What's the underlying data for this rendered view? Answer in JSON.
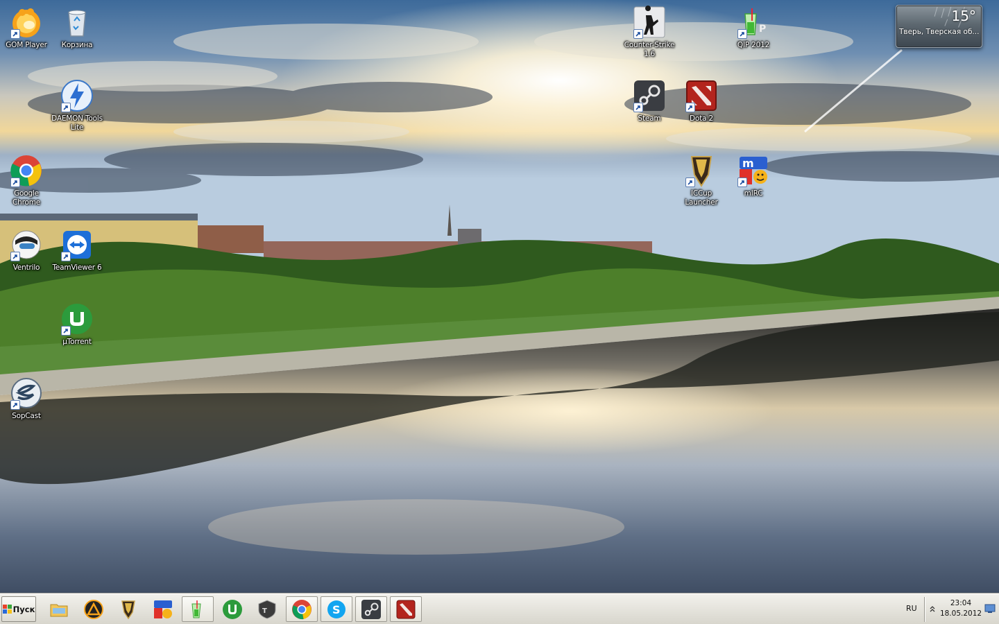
{
  "desktop": {
    "icons": [
      {
        "id": "gom-player",
        "label": "GOM Player",
        "icon": "gom-player-icon",
        "shortcut": true
      },
      {
        "id": "recycle-bin",
        "label": "Корзина",
        "icon": "recycle-bin-icon",
        "shortcut": false
      },
      {
        "id": "daemon-tools",
        "label": "DAEMON Tools Lite",
        "icon": "daemon-tools-icon",
        "shortcut": true
      },
      {
        "id": "google-chrome",
        "label": "Google Chrome",
        "icon": "chrome-icon",
        "shortcut": true
      },
      {
        "id": "ventrilo",
        "label": "Ventrilo",
        "icon": "ventrilo-icon",
        "shortcut": true
      },
      {
        "id": "teamviewer",
        "label": "TeamViewer 6",
        "icon": "teamviewer-icon",
        "shortcut": true
      },
      {
        "id": "utorrent",
        "label": "µTorrent",
        "icon": "utorrent-icon",
        "shortcut": true
      },
      {
        "id": "sopcast",
        "label": "SopCast",
        "icon": "sopcast-icon",
        "shortcut": true
      },
      {
        "id": "counter-strike",
        "label": "Counter-Strike 1.6",
        "icon": "counter-strike-icon",
        "shortcut": true
      },
      {
        "id": "qip",
        "label": "QIP 2012",
        "icon": "qip-icon",
        "shortcut": true
      },
      {
        "id": "steam",
        "label": "Steam",
        "icon": "steam-icon",
        "shortcut": true
      },
      {
        "id": "dota2",
        "label": "Dota 2",
        "icon": "dota2-icon",
        "shortcut": true
      },
      {
        "id": "iccup",
        "label": "ICCup Launcher",
        "icon": "iccup-icon",
        "shortcut": true
      },
      {
        "id": "mirc",
        "label": "mIRC",
        "icon": "mirc-icon",
        "shortcut": true
      }
    ]
  },
  "weather_gadget": {
    "temperature": "15°",
    "location": "Тверь, Тверская об..."
  },
  "taskbar": {
    "start_label": "Пуск",
    "buttons": [
      {
        "id": "explorer",
        "icon": "file-explorer-icon",
        "running": false
      },
      {
        "id": "aimp",
        "icon": "aimp-icon",
        "running": false
      },
      {
        "id": "iccup",
        "icon": "iccup-icon",
        "running": false
      },
      {
        "id": "mirc",
        "icon": "mirc-icon",
        "running": false
      },
      {
        "id": "qip",
        "icon": "qip-icon",
        "running": true
      },
      {
        "id": "utorrent",
        "icon": "utorrent-icon",
        "running": false
      },
      {
        "id": "world-of-tanks",
        "icon": "world-of-tanks-icon",
        "running": false
      },
      {
        "id": "chrome",
        "icon": "chrome-icon",
        "running": true
      },
      {
        "id": "skype",
        "icon": "skype-icon",
        "running": true
      },
      {
        "id": "steam",
        "icon": "steam-icon",
        "running": true
      },
      {
        "id": "dota2",
        "icon": "dota2-icon",
        "running": true
      }
    ],
    "tray": {
      "language": "RU",
      "time": "23:04",
      "date": "18.05.2012"
    }
  }
}
